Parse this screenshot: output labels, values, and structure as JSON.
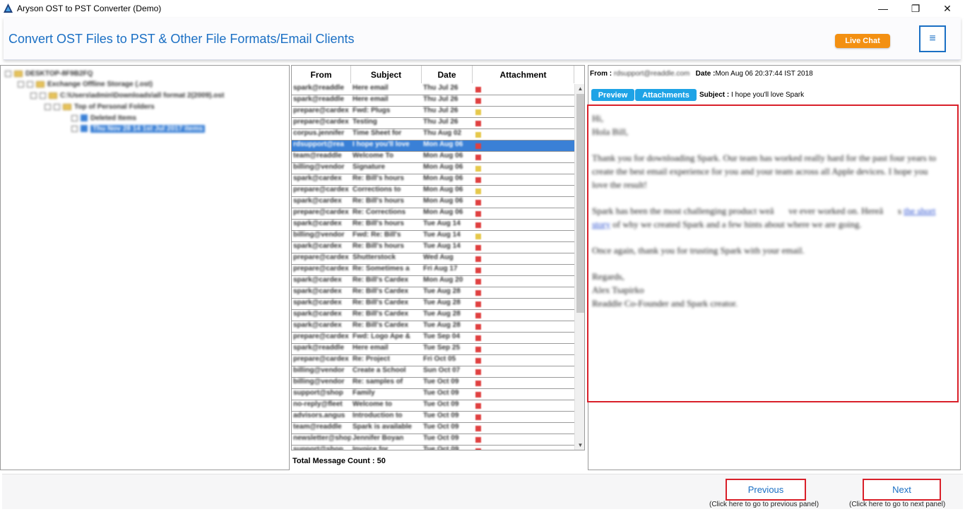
{
  "window": {
    "title": "Aryson OST to PST Converter (Demo)",
    "minimize_glyph": "—",
    "maximize_glyph": "❐",
    "close_glyph": "✕"
  },
  "header": {
    "title": "Convert OST Files to PST & Other File Formats/Email Clients",
    "live_chat_label": "Live Chat",
    "menu_glyph": "≡"
  },
  "tree": {
    "items": [
      {
        "label": "DESKTOP-8F9B2FQ"
      },
      {
        "label": "Exchange Offline Storage (.ost)"
      },
      {
        "label": "C:\\Users\\admin\\Downloads\\all format 2(2009).ost"
      },
      {
        "label": "Top of Personal Folders"
      },
      {
        "label": "Deleted Items"
      },
      {
        "label": "Thu Nov 28 14 1st Jul 2017 items"
      }
    ]
  },
  "message_list": {
    "columns": [
      "From",
      "Subject",
      "Date",
      "Attachment"
    ],
    "rows": [
      {
        "from": "spark@readdle",
        "subject": "Here email",
        "date": "Thu Jul 26",
        "flag": "red"
      },
      {
        "from": "spark@readdle",
        "subject": "Here email",
        "date": "Thu Jul 26",
        "flag": "red"
      },
      {
        "from": "prepare@cardex",
        "subject": "Fwd: Plugs",
        "date": "Thu Jul 26",
        "flag": "yellow"
      },
      {
        "from": "prepare@cardex",
        "subject": "Testing",
        "date": "Thu Jul 26",
        "flag": "red"
      },
      {
        "from": "corpus.jennifer",
        "subject": "Time Sheet for",
        "date": "Thu Aug 02",
        "flag": "yellow"
      },
      {
        "from": "rdsupport@rea",
        "subject": "I hope you'll love",
        "date": "Mon Aug 06",
        "flag": "red",
        "selected": true
      },
      {
        "from": "team@readdle",
        "subject": "Welcome To",
        "date": "Mon Aug 06",
        "flag": "red"
      },
      {
        "from": "billing@vendor",
        "subject": "Signature",
        "date": "Mon Aug 06",
        "flag": "yellow"
      },
      {
        "from": "spark@cardex",
        "subject": "Re: Bill's hours",
        "date": "Mon Aug 06",
        "flag": "red"
      },
      {
        "from": "prepare@cardex",
        "subject": "Corrections to",
        "date": "Mon Aug 06",
        "flag": "yellow"
      },
      {
        "from": "spark@cardex",
        "subject": "Re: Bill's hours",
        "date": "Mon Aug 06",
        "flag": "red"
      },
      {
        "from": "prepare@cardex",
        "subject": "Re: Corrections",
        "date": "Mon Aug 06",
        "flag": "red"
      },
      {
        "from": "spark@cardex",
        "subject": "Re: Bill's hours",
        "date": "Tue Aug 14",
        "flag": "red"
      },
      {
        "from": "billing@vendor",
        "subject": "Fwd: Re: Bill's",
        "date": "Tue Aug 14",
        "flag": "yellow"
      },
      {
        "from": "spark@cardex",
        "subject": "Re: Bill's hours",
        "date": "Tue Aug 14",
        "flag": "red"
      },
      {
        "from": "prepare@cardex",
        "subject": "Shutterstock",
        "date": "Wed Aug",
        "flag": "red"
      },
      {
        "from": "prepare@cardex",
        "subject": "Re: Sometimes a",
        "date": "Fri Aug 17",
        "flag": "red"
      },
      {
        "from": "spark@cardex",
        "subject": "Re: Bill's Cardex",
        "date": "Mon Aug 20",
        "flag": "red"
      },
      {
        "from": "spark@cardex",
        "subject": "Re: Bill's Cardex",
        "date": "Tue Aug 28",
        "flag": "red"
      },
      {
        "from": "spark@cardex",
        "subject": "Re: Bill's Cardex",
        "date": "Tue Aug 28",
        "flag": "red"
      },
      {
        "from": "spark@cardex",
        "subject": "Re: Bill's Cardex",
        "date": "Tue Aug 28",
        "flag": "red"
      },
      {
        "from": "spark@cardex",
        "subject": "Re: Bill's Cardex",
        "date": "Tue Aug 28",
        "flag": "red"
      },
      {
        "from": "prepare@cardex",
        "subject": "Fwd: Logo Ape &",
        "date": "Tue Sep 04",
        "flag": "red"
      },
      {
        "from": "spark@readdle",
        "subject": "Here email",
        "date": "Tue Sep 25",
        "flag": "red"
      },
      {
        "from": "prepare@cardex",
        "subject": "Re: Project",
        "date": "Fri Oct 05",
        "flag": "red"
      },
      {
        "from": "billing@vendor",
        "subject": "Create a School",
        "date": "Sun Oct 07",
        "flag": "red"
      },
      {
        "from": "billing@vendor",
        "subject": "Re: samples of",
        "date": "Tue Oct 09",
        "flag": "red"
      },
      {
        "from": "support@shop",
        "subject": "Family",
        "date": "Tue Oct 09",
        "flag": "red"
      },
      {
        "from": "no-reply@fleet",
        "subject": "Welcome to",
        "date": "Tue Oct 09",
        "flag": "red"
      },
      {
        "from": "advisors.angus",
        "subject": "Introduction to",
        "date": "Tue Oct 09",
        "flag": "red"
      },
      {
        "from": "team@readdle",
        "subject": "Spark is available",
        "date": "Tue Oct 09",
        "flag": "red"
      },
      {
        "from": "newsletter@shop",
        "subject": "Jennifer Boyan",
        "date": "Tue Oct 09",
        "flag": "red"
      },
      {
        "from": "support@shop",
        "subject": "Invoice for",
        "date": "Tue Oct 09",
        "flag": "red"
      }
    ],
    "total_label": "Total Message Count : 50"
  },
  "preview": {
    "from_label": "From :",
    "from_value": "rdsupport@readdle.com",
    "date_label": "Date :",
    "date_value": "Mon Aug 06 20:37:44 IST 2018",
    "tab_preview": "Preview",
    "tab_attachments": "Attachments",
    "subject_label": "Subject :",
    "subject_value": "I hope you'll love Spark",
    "body": {
      "greeting_1": "Hi,",
      "greeting_2": "Hola Bill,",
      "para_1": "Thank you for downloading Spark. Our team has worked really hard for the past four years to create the best email experience for you and your team across all Apple devices. I hope you love the result!",
      "para_2_pre": "Spark has been the most challenging product weâve ever worked on. Hereâs ",
      "para_2_link": "the short story",
      "para_2_post": " of why we created Spark and a few hints about where we are going.",
      "para_3": "Once again, thank you for trusting Spark with your email.",
      "sign_1": "Regards,",
      "sign_2": "Alex Tsapirko",
      "sign_3": "Readdle Co-Founder and Spark creator."
    }
  },
  "footer": {
    "previous_label": "Previous",
    "previous_hint": "(Click here to go to previous panel)",
    "next_label": "Next",
    "next_hint": "(Click here to go to next panel)"
  },
  "colors": {
    "accent_blue": "#1a6fc4",
    "live_chat_orange": "#f39012",
    "highlight_red": "#d9202a",
    "tab_blue": "#1ea3e6",
    "selection_blue": "#3a80d6"
  }
}
